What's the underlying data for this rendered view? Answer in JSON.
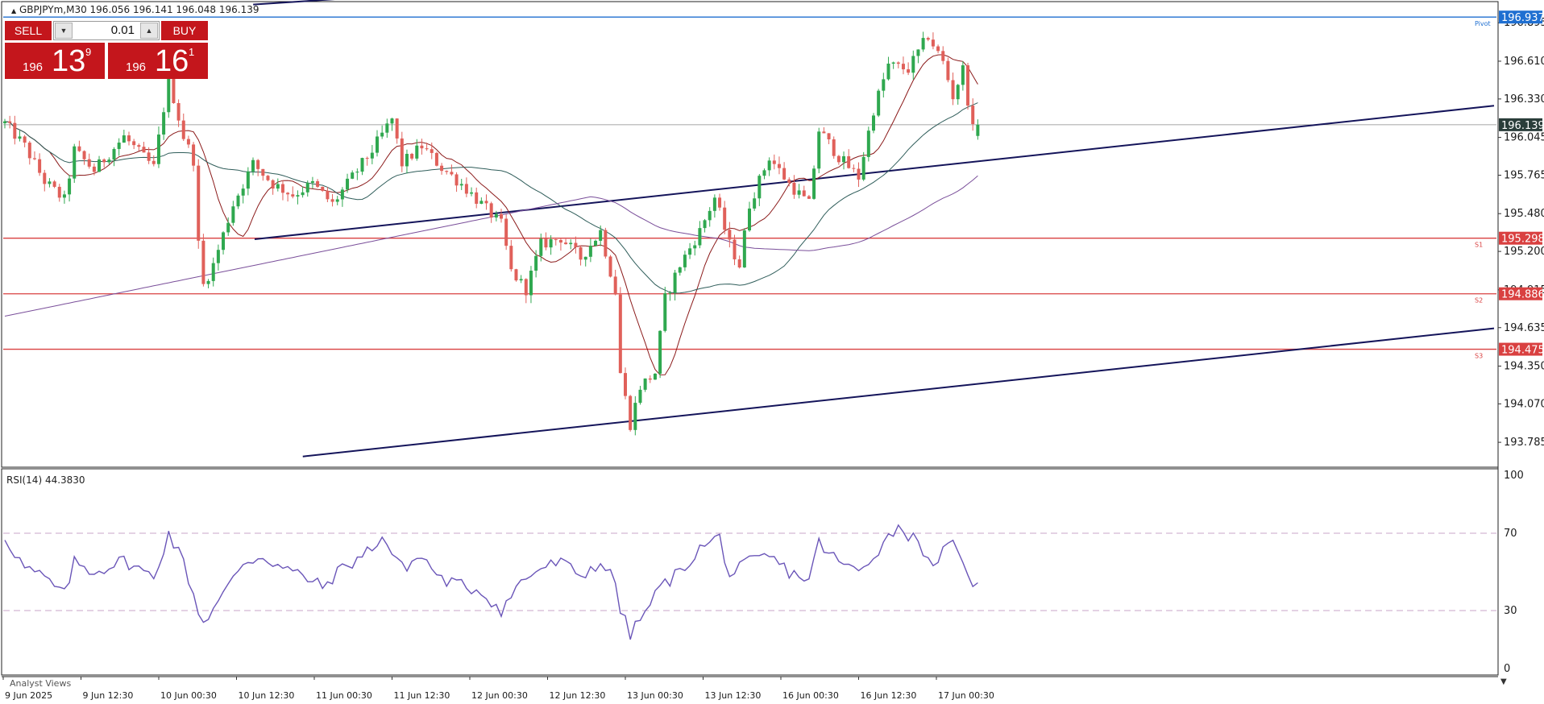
{
  "header": {
    "symbol_line": "GBPJPYm,M30  196.056 196.141 196.048 196.139",
    "rsi_label": "RSI(14) 44.3830",
    "analyst_views": "Analyst Views"
  },
  "trade_panel": {
    "sell_label": "SELL",
    "buy_label": "BUY",
    "lot_value": "0.01",
    "sell_price_prefix": "196",
    "sell_price_big": "13",
    "sell_price_sup": "9",
    "buy_price_prefix": "196",
    "buy_price_big": "16",
    "buy_price_sup": "1",
    "color": "#c4161c"
  },
  "chart_data": {
    "type": "candlestick",
    "symbol": "GBPJPYm",
    "timeframe": "M30",
    "ohlc_current": {
      "open": 196.056,
      "high": 196.141,
      "low": 196.048,
      "close": 196.139
    },
    "y_ticks": [
      "196.895",
      "196.610",
      "196.330",
      "196.045",
      "195.765",
      "195.480",
      "195.200",
      "194.915",
      "194.635",
      "194.350",
      "194.070",
      "193.785"
    ],
    "ylim": [
      193.72,
      196.98
    ],
    "x_ticks": [
      "9 Jun 2025",
      "9 Jun 12:30",
      "10 Jun 00:30",
      "10 Jun 12:30",
      "11 Jun 00:30",
      "11 Jun 12:30",
      "12 Jun 00:30",
      "12 Jun 12:30",
      "13 Jun 00:30",
      "13 Jun 12:30",
      "16 Jun 00:30",
      "16 Jun 12:30",
      "17 Jun 00:30"
    ],
    "bars_count": 196,
    "current_price": {
      "value": "196.139",
      "color": "#000000"
    },
    "levels": [
      {
        "name": "Pivot",
        "value": "196.937",
        "color": "#1f6fd1"
      },
      {
        "name": "S1",
        "value": "195.298",
        "color": "#d94040"
      },
      {
        "name": "S2",
        "value": "194.886",
        "color": "#d94040"
      },
      {
        "name": "S3",
        "value": "194.475",
        "color": "#d94040"
      }
    ],
    "trendlines": [
      {
        "from": [
          51,
          195.29
        ],
        "to": [
          300,
          196.28
        ]
      },
      {
        "from": [
          61,
          193.68
        ],
        "to": [
          300,
          194.63
        ]
      },
      {
        "from": [
          51,
          197.03
        ],
        "to": [
          75,
          197.09
        ]
      }
    ],
    "candles_keypoints": [
      [
        0,
        196.15
      ],
      [
        4,
        195.98
      ],
      [
        8,
        195.72
      ],
      [
        12,
        195.58
      ],
      [
        14,
        195.95
      ],
      [
        18,
        195.8
      ],
      [
        24,
        196.05
      ],
      [
        30,
        195.82
      ],
      [
        33,
        196.48
      ],
      [
        36,
        196.05
      ],
      [
        38,
        195.88
      ],
      [
        39,
        195.25
      ],
      [
        40,
        194.95
      ],
      [
        42,
        195.1
      ],
      [
        46,
        195.55
      ],
      [
        50,
        195.85
      ],
      [
        54,
        195.7
      ],
      [
        58,
        195.62
      ],
      [
        62,
        195.7
      ],
      [
        66,
        195.55
      ],
      [
        70,
        195.75
      ],
      [
        74,
        195.95
      ],
      [
        78,
        196.18
      ],
      [
        80,
        195.85
      ],
      [
        84,
        195.98
      ],
      [
        88,
        195.82
      ],
      [
        92,
        195.7
      ],
      [
        96,
        195.55
      ],
      [
        100,
        195.4
      ],
      [
        102,
        195.05
      ],
      [
        105,
        194.92
      ],
      [
        108,
        195.25
      ],
      [
        112,
        195.3
      ],
      [
        116,
        195.15
      ],
      [
        120,
        195.35
      ],
      [
        123,
        194.9
      ],
      [
        124,
        194.3
      ],
      [
        126,
        193.92
      ],
      [
        128,
        194.2
      ],
      [
        131,
        194.3
      ],
      [
        133,
        194.85
      ],
      [
        136,
        195.1
      ],
      [
        140,
        195.35
      ],
      [
        143,
        195.6
      ],
      [
        146,
        195.25
      ],
      [
        148,
        195.1
      ],
      [
        150,
        195.55
      ],
      [
        154,
        195.9
      ],
      [
        158,
        195.7
      ],
      [
        162,
        195.55
      ],
      [
        164,
        196.1
      ],
      [
        168,
        195.9
      ],
      [
        172,
        195.75
      ],
      [
        175,
        196.25
      ],
      [
        178,
        196.58
      ],
      [
        182,
        196.55
      ],
      [
        186,
        196.8
      ],
      [
        189,
        196.6
      ],
      [
        191,
        196.35
      ],
      [
        193,
        196.55
      ],
      [
        195,
        196.1
      ],
      [
        196,
        196.139
      ]
    ],
    "moving_averages": [
      {
        "name": "MA-fast",
        "color": "#8b1a1a"
      },
      {
        "name": "MA-mid",
        "color": "#2f5d5a"
      },
      {
        "name": "MA-slow",
        "color": "#7a4f9a"
      }
    ]
  },
  "rsi_data": {
    "type": "line",
    "period": 14,
    "value": "44.3830",
    "color": "#6a55b8",
    "levels": [
      "70",
      "30"
    ],
    "y_ticks": [
      "100",
      "70",
      "30",
      "0"
    ],
    "ylim": [
      0,
      100
    ],
    "keypoints": [
      [
        0,
        68
      ],
      [
        4,
        52
      ],
      [
        8,
        47
      ],
      [
        12,
        38
      ],
      [
        14,
        55
      ],
      [
        18,
        50
      ],
      [
        24,
        56
      ],
      [
        30,
        47
      ],
      [
        33,
        70
      ],
      [
        36,
        55
      ],
      [
        39,
        30
      ],
      [
        40,
        24
      ],
      [
        44,
        38
      ],
      [
        48,
        55
      ],
      [
        52,
        58
      ],
      [
        56,
        52
      ],
      [
        60,
        48
      ],
      [
        64,
        42
      ],
      [
        68,
        52
      ],
      [
        72,
        58
      ],
      [
        76,
        68
      ],
      [
        80,
        52
      ],
      [
        84,
        58
      ],
      [
        88,
        46
      ],
      [
        92,
        43
      ],
      [
        96,
        40
      ],
      [
        100,
        30
      ],
      [
        104,
        45
      ],
      [
        108,
        52
      ],
      [
        112,
        55
      ],
      [
        116,
        48
      ],
      [
        120,
        55
      ],
      [
        123,
        45
      ],
      [
        124,
        30
      ],
      [
        126,
        18
      ],
      [
        128,
        25
      ],
      [
        132,
        42
      ],
      [
        136,
        50
      ],
      [
        140,
        62
      ],
      [
        144,
        68
      ],
      [
        146,
        48
      ],
      [
        150,
        55
      ],
      [
        154,
        58
      ],
      [
        158,
        50
      ],
      [
        162,
        46
      ],
      [
        164,
        65
      ],
      [
        168,
        55
      ],
      [
        172,
        50
      ],
      [
        176,
        62
      ],
      [
        180,
        74
      ],
      [
        184,
        65
      ],
      [
        188,
        52
      ],
      [
        190,
        68
      ],
      [
        192,
        58
      ],
      [
        194,
        46
      ],
      [
        196,
        44.38
      ]
    ]
  }
}
